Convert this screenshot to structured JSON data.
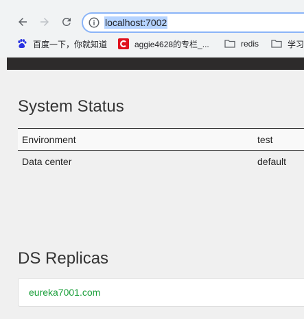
{
  "browser": {
    "url": "localhost:7002",
    "bookmarks": [
      {
        "label": "百度一下，你就知道",
        "icon": "baidu-paw-icon"
      },
      {
        "label": "aggie4628的专栏_...",
        "icon": "csdn-icon"
      },
      {
        "label": "redis",
        "icon": "folder-icon"
      },
      {
        "label": "学习",
        "icon": "folder-icon"
      }
    ]
  },
  "system_status": {
    "title": "System Status",
    "rows": [
      {
        "key": "Environment",
        "value": "test"
      },
      {
        "key": "Data center",
        "value": "default"
      }
    ]
  },
  "replicas": {
    "title": "DS Replicas",
    "items": [
      "eureka7001.com"
    ]
  },
  "colors": {
    "link_green": "#1a9f3a",
    "omnibox_focus": "#8ab4f8",
    "navbar_dark": "#2d2b2b"
  }
}
